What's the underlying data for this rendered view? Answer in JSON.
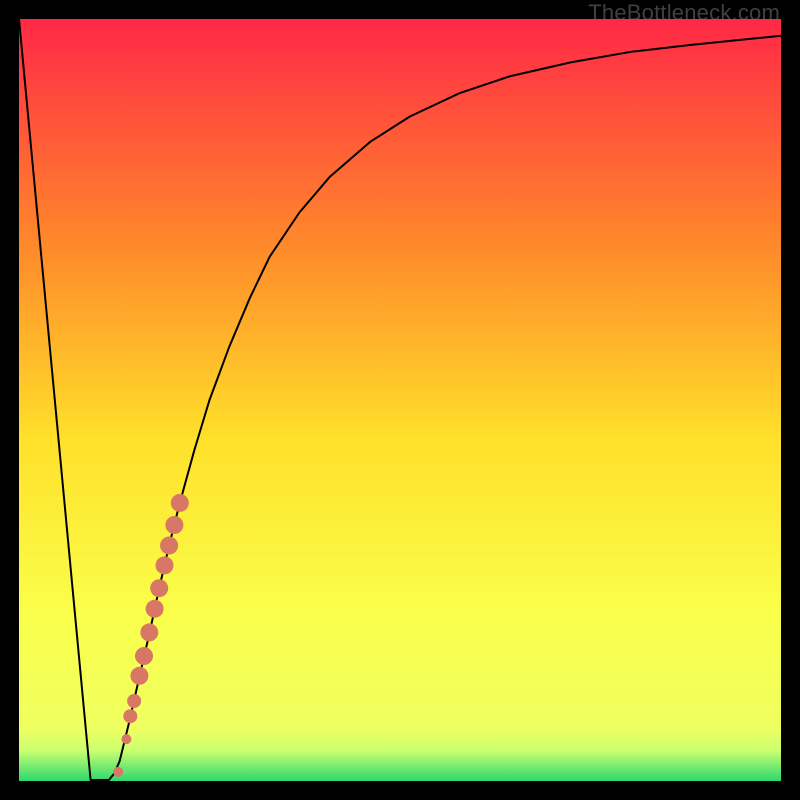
{
  "watermark": "TheBottleneck.com",
  "chart_data": {
    "type": "line",
    "title": "",
    "xlabel": "",
    "ylabel": "",
    "xlim": [
      0,
      100
    ],
    "ylim": [
      0,
      100
    ],
    "grid": false,
    "series": [
      {
        "name": "bottleneck-curve",
        "x": [
          0,
          4.7,
          9.4,
          10.5,
          11.8,
          12.5,
          13.2,
          14.5,
          15.7,
          17.1,
          18.4,
          19.7,
          21.1,
          23.0,
          25.0,
          27.6,
          30.3,
          32.9,
          36.8,
          40.8,
          46.1,
          51.3,
          57.9,
          64.5,
          72.4,
          80.3,
          88.2,
          96.1,
          100.0
        ],
        "y": [
          100.0,
          50.0,
          0.13,
          0.13,
          0.13,
          1.0,
          2.6,
          7.9,
          13.2,
          19.3,
          25.3,
          30.9,
          36.5,
          43.4,
          50.0,
          57.0,
          63.4,
          68.8,
          74.6,
          79.3,
          83.9,
          87.2,
          90.3,
          92.5,
          94.3,
          95.7,
          96.6,
          97.4,
          97.8
        ]
      }
    ],
    "scatter": {
      "name": "bottleneck-points",
      "color": "#d87766",
      "points": [
        {
          "x": 13.0,
          "y": 1.2,
          "r": 5
        },
        {
          "x": 14.1,
          "y": 5.5,
          "r": 5
        },
        {
          "x": 14.6,
          "y": 8.5,
          "r": 7
        },
        {
          "x": 15.1,
          "y": 10.5,
          "r": 7
        },
        {
          "x": 15.8,
          "y": 13.8,
          "r": 9
        },
        {
          "x": 16.4,
          "y": 16.4,
          "r": 9
        },
        {
          "x": 17.1,
          "y": 19.5,
          "r": 9
        },
        {
          "x": 17.8,
          "y": 22.6,
          "r": 9
        },
        {
          "x": 18.4,
          "y": 25.3,
          "r": 9
        },
        {
          "x": 19.1,
          "y": 28.3,
          "r": 9
        },
        {
          "x": 19.7,
          "y": 30.9,
          "r": 9
        },
        {
          "x": 20.4,
          "y": 33.6,
          "r": 9
        },
        {
          "x": 21.1,
          "y": 36.5,
          "r": 9
        }
      ]
    },
    "background_gradient": {
      "top": "#ff2846",
      "mid_upper": "#ff8a2a",
      "mid": "#ffe02a",
      "mid_lower": "#f9ff4a",
      "green_band_top": "#caff70",
      "green_band_bottom": "#2dd86f"
    }
  }
}
